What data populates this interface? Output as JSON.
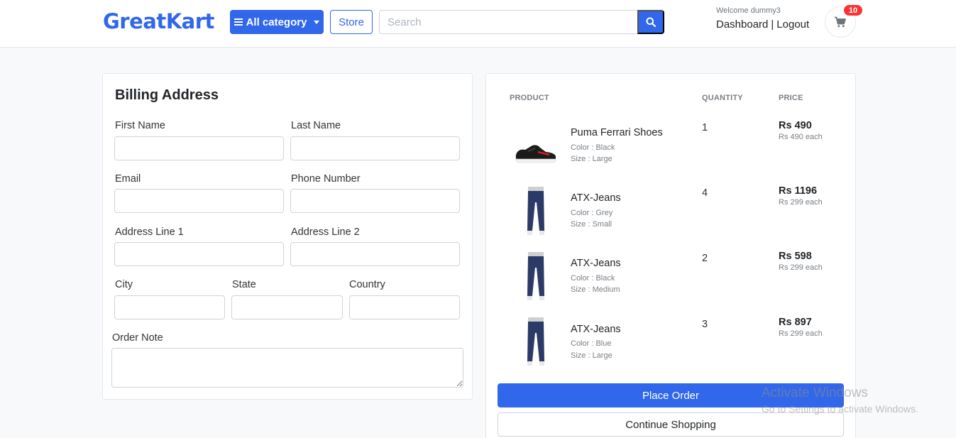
{
  "header": {
    "logo": "GreatKart",
    "category_button": "All category",
    "store_button": "Store",
    "search_placeholder": "Search",
    "welcome": "Welcome dummy3",
    "dashboard_link": "Dashboard",
    "separator": "|",
    "logout_link": "Logout",
    "cart_count": "10"
  },
  "billing": {
    "title": "Billing Address",
    "labels": {
      "first_name": "First Name",
      "last_name": "Last Name",
      "email": "Email",
      "phone": "Phone Number",
      "address1": "Address Line 1",
      "address2": "Address Line 2",
      "city": "City",
      "state": "State",
      "country": "Country",
      "order_note": "Order Note"
    }
  },
  "order": {
    "columns": {
      "product": "PRODUCT",
      "quantity": "QUANTITY",
      "price": "PRICE"
    },
    "items": [
      {
        "name": "Puma Ferrari Shoes",
        "color": "Color : Black",
        "size": "Size : Large",
        "quantity": "1",
        "total": "Rs 490",
        "each": "Rs 490 each",
        "image": "shoe"
      },
      {
        "name": "ATX-Jeans",
        "color": "Color : Grey",
        "size": "Size : Small",
        "quantity": "4",
        "total": "Rs 1196",
        "each": "Rs 299 each",
        "image": "jeans"
      },
      {
        "name": "ATX-Jeans",
        "color": "Color : Black",
        "size": "Size : Medium",
        "quantity": "2",
        "total": "Rs 598",
        "each": "Rs 299 each",
        "image": "jeans"
      },
      {
        "name": "ATX-Jeans",
        "color": "Color : Blue",
        "size": "Size : Large",
        "quantity": "3",
        "total": "Rs 897",
        "each": "Rs 299 each",
        "image": "jeans"
      }
    ],
    "place_order": "Place Order",
    "continue_shopping": "Continue Shopping"
  },
  "watermark": {
    "line1": "Activate Windows",
    "line2": "Go to Settings to activate Windows."
  },
  "colors": {
    "primary": "#3167eb",
    "badge": "#fa3434"
  }
}
